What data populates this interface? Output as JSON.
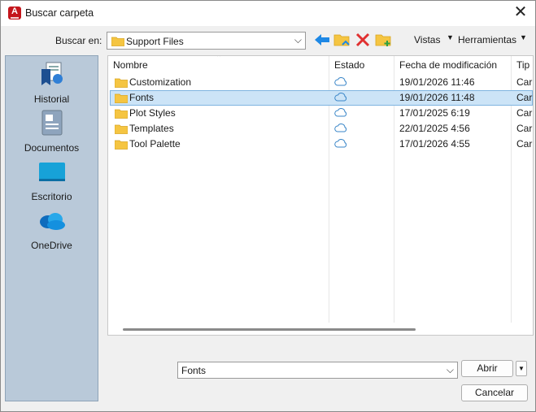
{
  "window": {
    "title": "Buscar carpeta"
  },
  "toolbar": {
    "look_in_label": "Buscar en:",
    "look_in_value": "Support Files",
    "views_label": "Vistas",
    "tools_label": "Herramientas"
  },
  "places": [
    {
      "label": "Historial"
    },
    {
      "label": "Documentos"
    },
    {
      "label": "Escritorio"
    },
    {
      "label": "OneDrive"
    }
  ],
  "columns": {
    "name": "Nombre",
    "status": "Estado",
    "modified": "Fecha de modificación",
    "type": "Tip"
  },
  "files": [
    {
      "name": "Customization",
      "modified": "19/01/2026 11:46",
      "type": "Car"
    },
    {
      "name": "Fonts",
      "modified": "19/01/2026 11:48",
      "type": "Car",
      "selected": true
    },
    {
      "name": "Plot Styles",
      "modified": "17/01/2025 6:19",
      "type": "Car"
    },
    {
      "name": "Templates",
      "modified": "22/01/2025 4:56",
      "type": "Car"
    },
    {
      "name": "Tool Palette",
      "modified": "17/01/2026 4:55",
      "type": "Car"
    }
  ],
  "footer": {
    "filename_value": "Fonts",
    "open_label": "Abrir",
    "cancel_label": "Cancelar"
  },
  "colors": {
    "selection_bg": "#cce4f7",
    "places_bg": "#b9c9d9",
    "folder": "#f5c542",
    "cloud": "#3a86c8",
    "delete": "#e03030",
    "back_arrow": "#1e88e5"
  }
}
